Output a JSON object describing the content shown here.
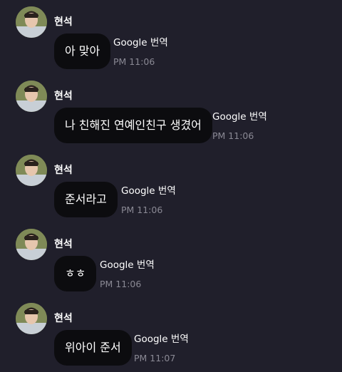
{
  "messages": [
    {
      "sender": "현석",
      "text": "아 맞아",
      "translate_label": "Google 번역",
      "time": "PM 11:06"
    },
    {
      "sender": "현석",
      "text": "나 친해진 연예인친구 생겼어",
      "translate_label": "Google 번역",
      "time": "PM 11:06"
    },
    {
      "sender": "현석",
      "text": "준서라고",
      "translate_label": "Google 번역",
      "time": "PM 11:06"
    },
    {
      "sender": "현석",
      "text": "ㅎㅎ",
      "translate_label": "Google 번역",
      "time": "PM 11:06"
    },
    {
      "sender": "현석",
      "text": "위아이 준서",
      "translate_label": "Google 번역",
      "time": "PM 11:07"
    }
  ],
  "colors": {
    "background": "#201f2b",
    "bubble": "#0c0c0f",
    "time": "#8a8994",
    "text": "#ffffff"
  },
  "icons": {
    "avatar": "profile-photo"
  }
}
